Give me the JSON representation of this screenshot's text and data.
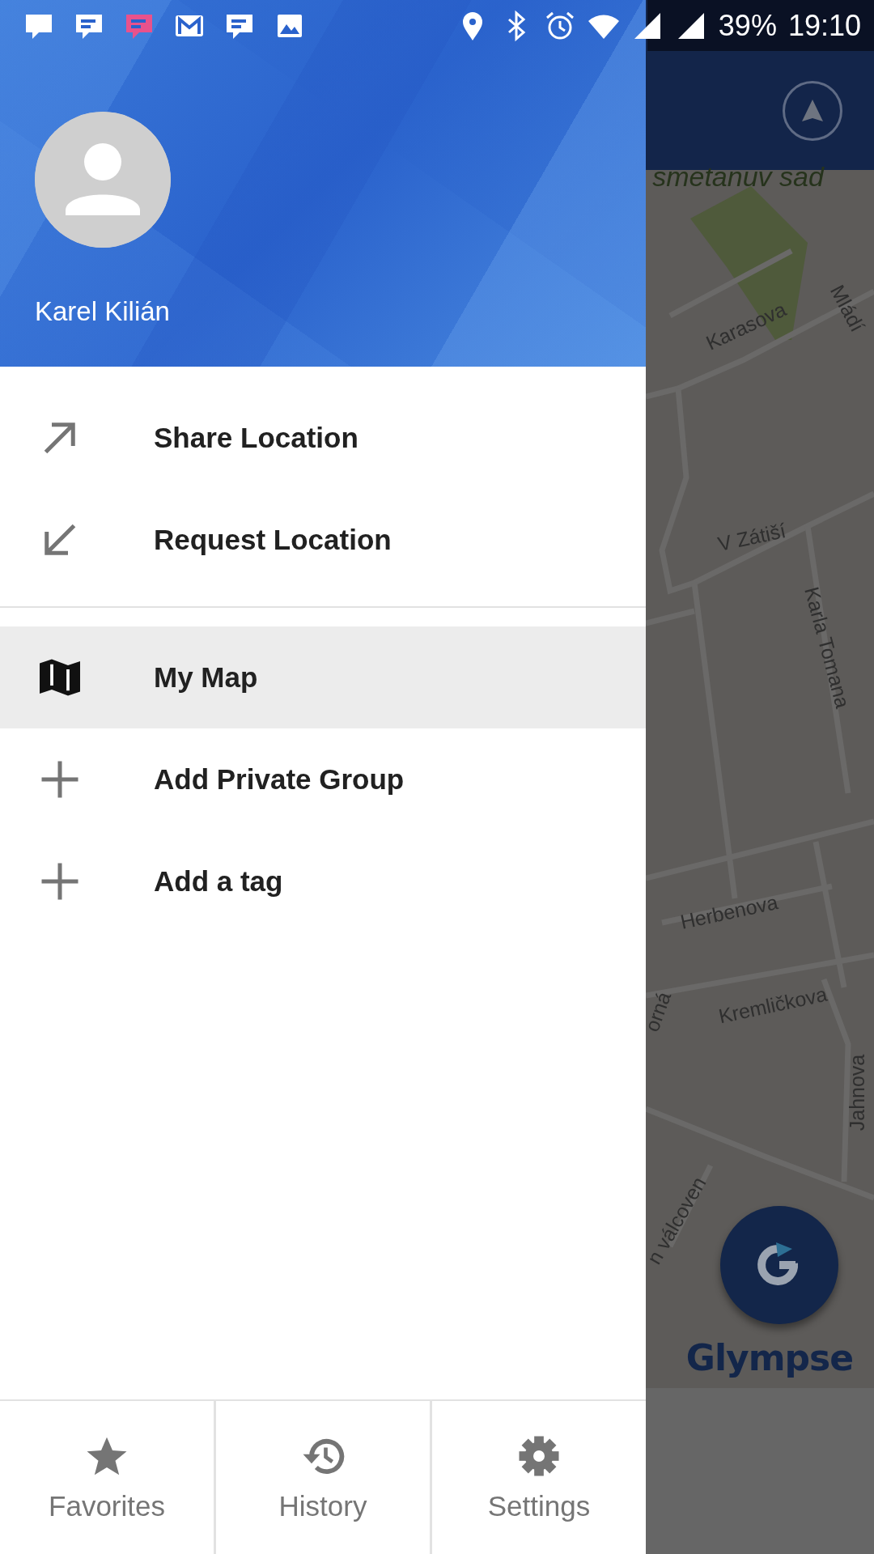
{
  "status_bar": {
    "battery": "39%",
    "time": "19:10"
  },
  "header": {
    "user_name": "Karel Kilián"
  },
  "menu_sections": [
    {
      "items": [
        {
          "label": "Share Location",
          "kind": "arrow_out",
          "selected": false
        },
        {
          "label": "Request Location",
          "kind": "arrow_in",
          "selected": false
        }
      ]
    },
    {
      "items": [
        {
          "label": "My Map",
          "kind": "map",
          "selected": true
        },
        {
          "label": "Add Private Group",
          "kind": "plus",
          "selected": false
        },
        {
          "label": "Add a tag",
          "kind": "plus",
          "selected": false
        }
      ]
    }
  ],
  "bottom_nav": [
    {
      "label": "Favorites",
      "kind": "star"
    },
    {
      "label": "History",
      "kind": "history"
    },
    {
      "label": "Settings",
      "kind": "gear"
    }
  ],
  "map": {
    "place_labels": [
      {
        "text": "smetanuv sad",
        "kind": "park"
      },
      {
        "text": "Karasova",
        "kind": "street"
      },
      {
        "text": "Mládí",
        "kind": "street"
      },
      {
        "text": "V Zátiší",
        "kind": "street"
      },
      {
        "text": "Karla Tomana",
        "kind": "street"
      },
      {
        "text": "Herbenova",
        "kind": "street"
      },
      {
        "text": "orná",
        "kind": "street"
      },
      {
        "text": "Kremličkova",
        "kind": "street"
      },
      {
        "text": "Jahnova",
        "kind": "street"
      },
      {
        "text": "n válcoven",
        "kind": "street"
      }
    ],
    "logo": "Glympse"
  }
}
